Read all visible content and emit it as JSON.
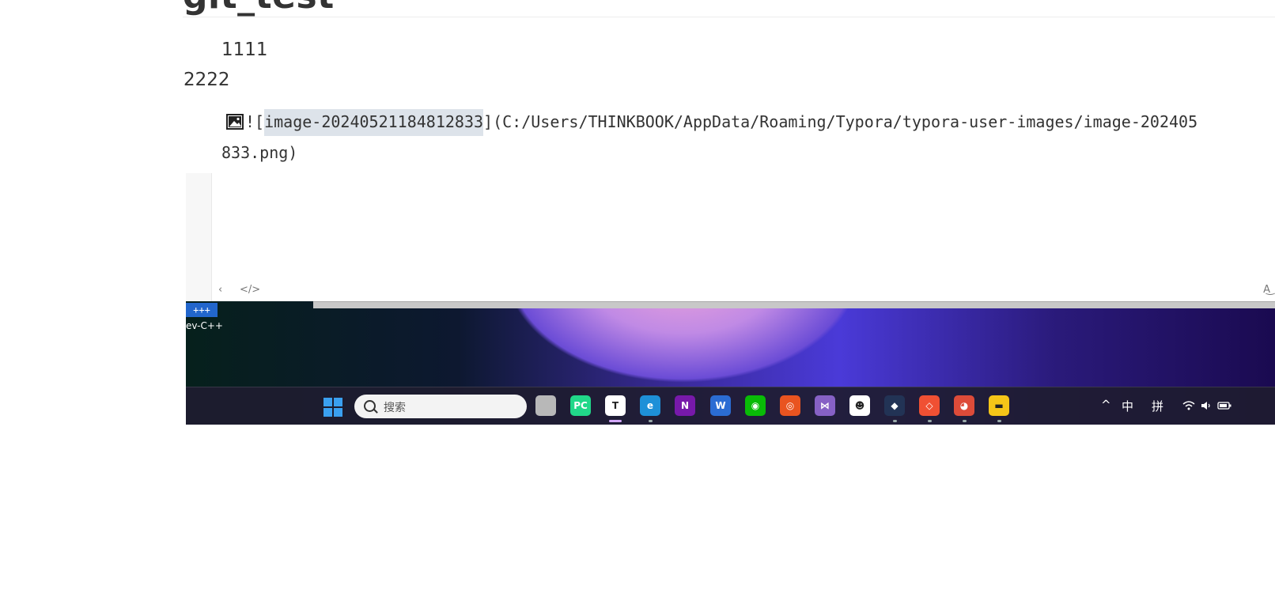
{
  "document": {
    "heading": "git_test",
    "paragraph1": "1111",
    "paragraph2": "2222",
    "markdown_prefix": "![",
    "image_alt": "image-20240521184812833",
    "markdown_path": "](C:/Users/THINKBOOK/AppData/Roaming/Typora/typora-user-images/image-202405",
    "markdown_line2": "833.png)"
  },
  "editor_toolbar": {
    "back_label": "‹",
    "code_label": "</>",
    "spell_label": "A͜"
  },
  "screenshot": {
    "desktop_icon_label": "ev-C++",
    "desktop_icon_glyph": "+++",
    "taskbar": {
      "search_placeholder": "搜索",
      "apps": [
        {
          "name": "task-view",
          "glyph": "",
          "color": "#b8b8b8"
        },
        {
          "name": "pycharm",
          "glyph": "PC",
          "color": "#21d789"
        },
        {
          "name": "typora",
          "glyph": "T",
          "color": "#ffffff"
        },
        {
          "name": "edge",
          "glyph": "e",
          "color": "#1e90d8"
        },
        {
          "name": "onenote",
          "glyph": "N",
          "color": "#7719aa"
        },
        {
          "name": "word",
          "glyph": "W",
          "color": "#2b6cd3"
        },
        {
          "name": "wechat",
          "glyph": "◉",
          "color": "#09bb07"
        },
        {
          "name": "ubuntu",
          "glyph": "◎",
          "color": "#e95420"
        },
        {
          "name": "visual-studio",
          "glyph": "⋈",
          "color": "#8661c5"
        },
        {
          "name": "qq",
          "glyph": "☻",
          "color": "#ffffff"
        },
        {
          "name": "cat-app",
          "glyph": "◆",
          "color": "#223355"
        },
        {
          "name": "git-gui",
          "glyph": "◇",
          "color": "#f05033"
        },
        {
          "name": "chrome",
          "glyph": "◕",
          "color": "#dd4b39"
        },
        {
          "name": "file-explorer",
          "glyph": "▬",
          "color": "#f5c518"
        }
      ],
      "tray": {
        "chevron": "^",
        "ime_lang": "中",
        "ime_mode": "拼"
      }
    }
  }
}
